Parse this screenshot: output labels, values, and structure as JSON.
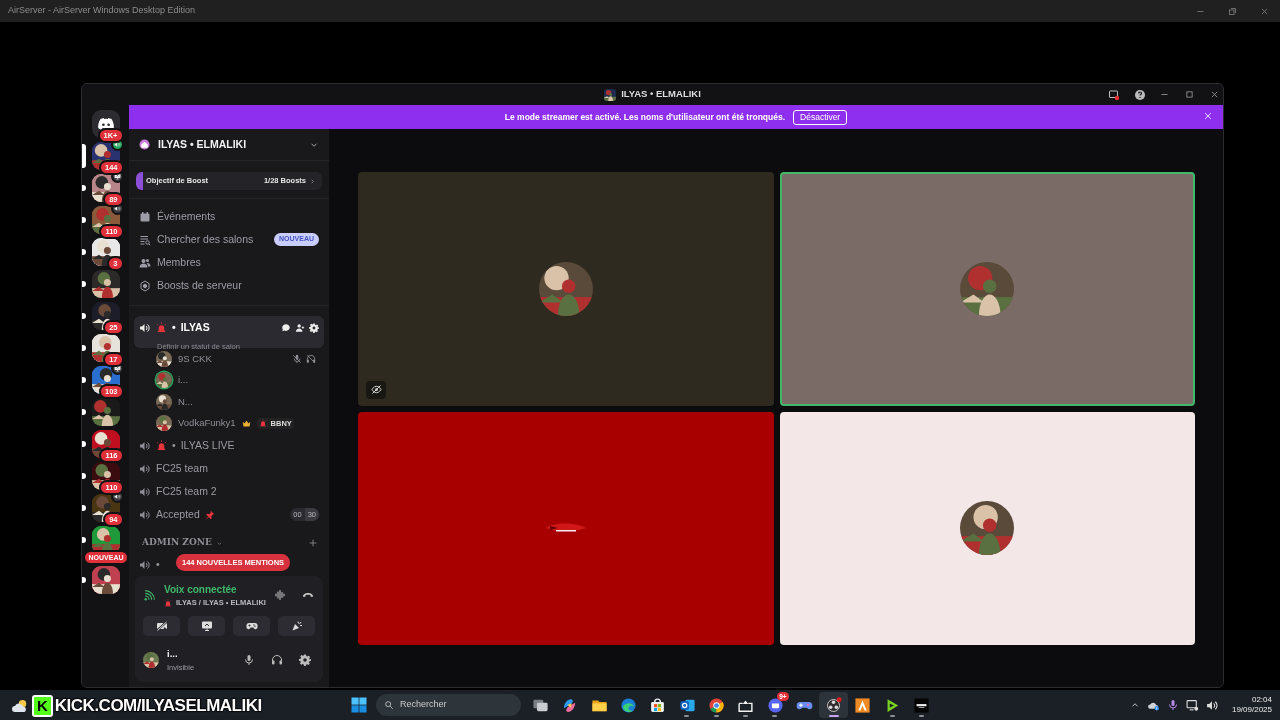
{
  "os_window": {
    "title": "AirServer - AirServer Windows Desktop Edition"
  },
  "discord": {
    "title": "ILYAS • ELMALIKI",
    "banner": {
      "text": "Le mode streamer est activé. Les noms d'utilisateur ont été tronqués.",
      "button": "Désactiver"
    },
    "servers": [
      {
        "kind": "home",
        "badge": "1K+",
        "selected": false,
        "unread": false
      },
      {
        "kind": "server",
        "color": "#2a3370",
        "badge": "144",
        "selected": true,
        "unread": false,
        "indicator": {
          "kind": "voice"
        }
      },
      {
        "kind": "server",
        "color": "#b8868a",
        "badge": "89",
        "selected": false,
        "unread": true,
        "indicator": {
          "kind": "screen"
        }
      },
      {
        "kind": "server",
        "color": "#8a5a3a",
        "badge": "110",
        "selected": false,
        "unread": true,
        "indicator": {
          "kind": "speaker"
        }
      },
      {
        "kind": "server",
        "color": "#e8e8e8",
        "badge": "3",
        "selected": false,
        "unread": true
      },
      {
        "kind": "server",
        "color": "#2b2a28",
        "selected": false,
        "unread": true
      },
      {
        "kind": "server",
        "color": "#1d1d2a",
        "badge": "25",
        "selected": false,
        "unread": true
      },
      {
        "kind": "server",
        "color": "#e6e2dc",
        "badge": "17",
        "selected": false,
        "unread": true
      },
      {
        "kind": "server",
        "color": "#2a6fd0",
        "badge": "103",
        "selected": false,
        "unread": true,
        "indicator": {
          "kind": "screen"
        }
      },
      {
        "kind": "server",
        "color": "#1a1a1a",
        "selected": false,
        "unread": true
      },
      {
        "kind": "server",
        "color": "#c01020",
        "badge": "116",
        "selected": false,
        "unread": true
      },
      {
        "kind": "server",
        "color": "#3a0c10",
        "badge": "110",
        "selected": false,
        "unread": true
      },
      {
        "kind": "server",
        "color": "#4a3512",
        "badge": "94",
        "selected": false,
        "unread": true,
        "indicator": {
          "kind": "speaker"
        }
      },
      {
        "kind": "server",
        "color": "#1f9a3a",
        "badge": "NOUVEAU",
        "selected": false,
        "unread": true
      },
      {
        "kind": "server",
        "color": "#c04050",
        "selected": false,
        "unread": true
      }
    ],
    "server_name": "ILYAS • ELMALIKI",
    "boost": {
      "label": "Objectif de Boost",
      "progress": "1/28 Boosts",
      "level": 0.04
    },
    "nav": [
      {
        "kind": "events",
        "label": "Événements"
      },
      {
        "kind": "browse",
        "label": "Chercher des salons",
        "badge": "NOUVEAU"
      },
      {
        "kind": "members",
        "label": "Membres"
      },
      {
        "kind": "boosts",
        "label": "Boosts de serveur"
      }
    ],
    "channels": [
      {
        "kind": "voice",
        "siren": true,
        "separator": "•",
        "name": "ILYAS",
        "selected": true,
        "status": "Définir un statut de salon",
        "members": [
          {
            "name": "9S CKK",
            "speaking": false,
            "muted": true,
            "deafened": true
          },
          {
            "name": "i...",
            "speaking": true,
            "muted": false,
            "deafened": false
          },
          {
            "name": "N...",
            "speaking": false,
            "muted": false,
            "deafened": false
          },
          {
            "name": "VodkaFunky1",
            "speaking": false,
            "muted": false,
            "deafened": false,
            "crown": true,
            "tag": "BBNY"
          }
        ]
      },
      {
        "kind": "voice",
        "siren": true,
        "separator": "•",
        "name": "ILYAS LIVE",
        "selected": false
      },
      {
        "kind": "voice",
        "siren": false,
        "name": "FC25 team",
        "selected": false
      },
      {
        "kind": "voice",
        "siren": false,
        "name": "FC25 team 2",
        "selected": false
      },
      {
        "kind": "voice",
        "siren": false,
        "name": "Accepted",
        "pin": true,
        "limit": [
          "00",
          "30"
        ],
        "selected": false
      }
    ],
    "category": {
      "name": "ADMIN ZONE",
      "channels": [
        {
          "kind": "voice",
          "separator": "•"
        }
      ]
    },
    "mentions_pill": "144 NOUVELLES MENTIONS",
    "voice_panel": {
      "status": "Voix connectée",
      "channel": "ILYAS / ILYAS • ELMALIKI",
      "buttons": [
        {
          "kind": "camera"
        },
        {
          "kind": "screen"
        },
        {
          "kind": "activity"
        },
        {
          "kind": "soundboard"
        }
      ]
    },
    "user": {
      "name": "i...",
      "status": "Invisible"
    },
    "tiles": [
      {
        "color": "#2e2a20",
        "kind": "avatar",
        "speaking": false,
        "video_hidden": true
      },
      {
        "color": "#7b6b66",
        "kind": "avatar",
        "speaking": true,
        "video_hidden": false
      },
      {
        "color": "#a80000",
        "kind": "logo",
        "speaking": false,
        "video_hidden": false
      },
      {
        "color": "#f3e7e7",
        "kind": "avatar",
        "speaking": false,
        "video_hidden": false
      }
    ]
  },
  "overlay": {
    "logo": "K",
    "text": "KICK.COM/ILYASELMALIKI"
  },
  "taskbar": {
    "search": {
      "placeholder": "Rechercher"
    },
    "apps": [
      {
        "kind": "taskview",
        "running": false,
        "selected": false
      },
      {
        "kind": "swirl",
        "running": false,
        "selected": false
      },
      {
        "kind": "folder",
        "running": false,
        "selected": false
      },
      {
        "kind": "wave",
        "running": false,
        "selected": false
      },
      {
        "kind": "bag",
        "running": false,
        "selected": false
      },
      {
        "kind": "mail",
        "running": true,
        "selected": false
      },
      {
        "kind": "ring",
        "running": true,
        "selected": false
      },
      {
        "kind": "tray",
        "running": true,
        "selected": false
      },
      {
        "kind": "chat",
        "running": true,
        "selected": false,
        "badge": "9+"
      },
      {
        "kind": "gamepad",
        "running": false,
        "selected": false
      },
      {
        "kind": "record",
        "running": true,
        "selected": true
      },
      {
        "kind": "orange",
        "running": false,
        "selected": false
      },
      {
        "kind": "play",
        "running": true,
        "selected": false
      },
      {
        "kind": "dark",
        "running": true,
        "selected": false
      }
    ],
    "time": "02:04",
    "date": "19/09/2025"
  }
}
